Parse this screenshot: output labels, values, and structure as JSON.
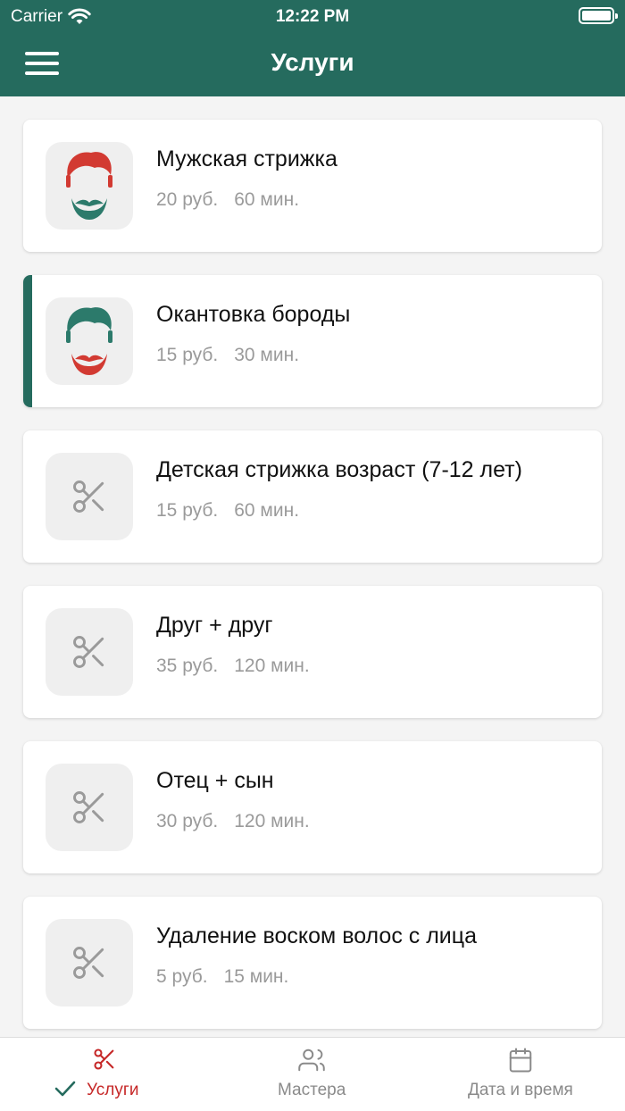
{
  "status_bar": {
    "carrier": "Carrier",
    "time": "12:22 PM"
  },
  "header": {
    "title": "Услуги",
    "menu_icon": "hamburger-menu-icon"
  },
  "colors": {
    "primary": "#256b5e",
    "accent_red": "#c62828",
    "muted": "#9a9a9a"
  },
  "services": [
    {
      "name": "Мужская стрижка",
      "price": "20 руб.",
      "duration": "60 мин.",
      "icon": "barber-red-hair-icon",
      "selected": false
    },
    {
      "name": "Окантовка бороды",
      "price": "15 руб.",
      "duration": "30 мин.",
      "icon": "barber-green-hair-icon",
      "selected": true
    },
    {
      "name": "Детская стрижка возраст (7-12 лет)",
      "price": "15 руб.",
      "duration": "60 мин.",
      "icon": "scissors-icon",
      "selected": false
    },
    {
      "name": "Друг + друг",
      "price": "35 руб.",
      "duration": "120 мин.",
      "icon": "scissors-icon",
      "selected": false
    },
    {
      "name": "Отец + сын",
      "price": "30 руб.",
      "duration": "120 мин.",
      "icon": "scissors-icon",
      "selected": false
    },
    {
      "name": "Удаление воском волос с лица",
      "price": "5 руб.",
      "duration": "15 мин.",
      "icon": "scissors-icon",
      "selected": false
    }
  ],
  "tabbar": {
    "services": {
      "label": "Услуги",
      "icon": "scissors-icon",
      "active": true
    },
    "masters": {
      "label": "Мастера",
      "icon": "users-icon",
      "active": false
    },
    "datetime": {
      "label": "Дата и время",
      "icon": "calendar-icon",
      "active": false
    }
  }
}
